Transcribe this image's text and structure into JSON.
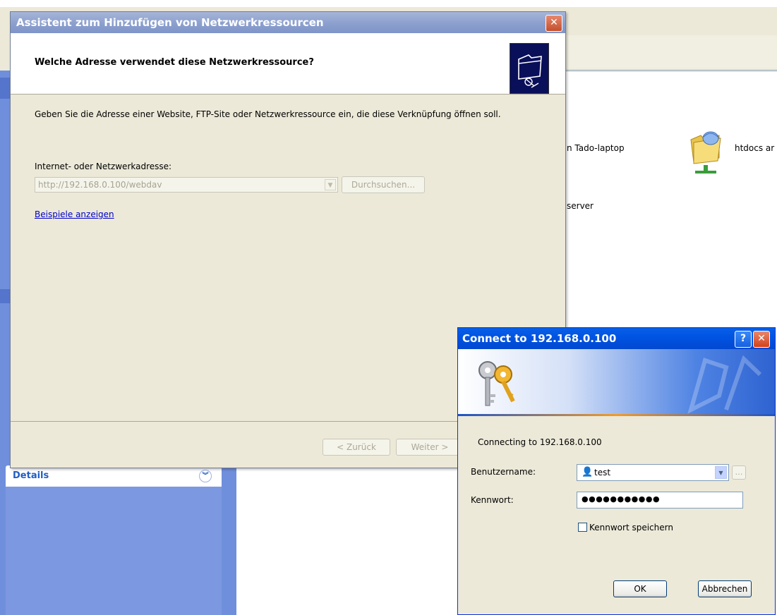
{
  "explorer": {
    "items": [
      {
        "label": "n Tado-laptop"
      },
      {
        "label": "htdocs ar"
      },
      {
        "label": "server"
      }
    ],
    "details_label": "Details"
  },
  "wizard": {
    "title": "Assistent zum Hinzufügen von Netzwerkressourcen",
    "heading": "Welche Adresse verwendet diese Netzwerkressource?",
    "description": "Geben Sie die Adresse einer Website, FTP-Site oder Netzwerkressource ein, die diese Verknüpfung öffnen soll.",
    "address_label": "Internet- oder Netzwerkadresse:",
    "address_value": "http://192.168.0.100/webdav",
    "browse_label": "Durchsuchen...",
    "examples_link": "Beispiele anzeigen",
    "back_label": "< Zurück",
    "next_label": "Weiter >"
  },
  "connect": {
    "title": "Connect to 192.168.0.100",
    "message": "Connecting to 192.168.0.100",
    "username_label": "Benutzername:",
    "username_value": "test",
    "password_label": "Kennwort:",
    "password_value": "●●●●●●●●●●●",
    "remember_label": "Kennwort speichern",
    "remember_checked": false,
    "ok_label": "OK",
    "cancel_label": "Abbrechen"
  },
  "colors": {
    "xp_title_blue": "#0054e3",
    "inactive_title": "#8ea1cf",
    "sidebar_blue": "#6f8fdc",
    "dialog_bg": "#ece9d8",
    "link_blue": "#0000cc"
  },
  "icons": [
    "close-icon",
    "help-icon",
    "network-folder-icon",
    "keys-icon",
    "user-icon",
    "chevron-down-icon"
  ]
}
